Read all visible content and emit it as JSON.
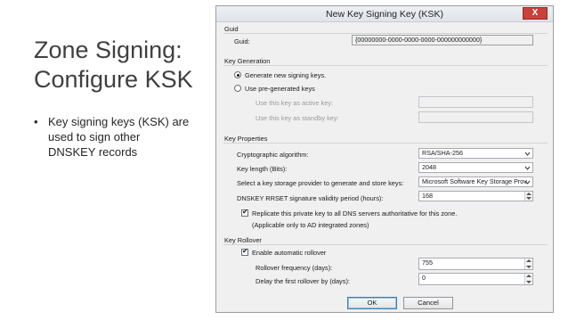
{
  "slide": {
    "title_line1": "Zone Signing:",
    "title_line2": "Configure KSK",
    "bullet_marker": "•",
    "bullet_line1": "Key signing keys (KSK) are",
    "bullet_line2": "used to sign other",
    "bullet_line3": "DNSKEY records"
  },
  "dialog": {
    "title": "New Key Signing Key (KSK)",
    "close_label": "X",
    "guid": {
      "group_label": "Guid",
      "field_label": "Guid:",
      "value": "{00000000-0000-0000-0000-000000000000}"
    },
    "key_generation": {
      "group_label": "Key Generation",
      "option_generate": "Generate new signing keys.",
      "option_pregenerated": "Use pre-generated keys",
      "active_key_label": "Use this key as active key:",
      "active_key_value": "",
      "standby_key_label": "Use this key as standby key:",
      "standby_key_value": "",
      "selected": "generate"
    },
    "key_properties": {
      "group_label": "Key Properties",
      "algorithm_label": "Cryptographic algorithm:",
      "algorithm_value": "RSA/SHA-256",
      "key_length_label": "Key length (Bits):",
      "key_length_value": "2048",
      "ksp_label": "Select a key storage provider to generate and store keys:",
      "ksp_value": "Microsoft Software Key Storage Prov",
      "rrset_label": "DNSKEY RRSET signature validity period (hours):",
      "rrset_value": "168",
      "replicate_label": "Replicate this private key to all DNS servers authoritative for this zone.",
      "replicate_note": "(Applicable only to AD integrated zones)",
      "replicate_checked": true
    },
    "key_rollover": {
      "group_label": "Key Rollover",
      "auto_rollover_label": "Enable automatic rollover",
      "auto_rollover_checked": true,
      "frequency_label": "Rollover frequency (days):",
      "frequency_value": "755",
      "delay_label": "Delay the first rollover by (days):",
      "delay_value": "0"
    },
    "buttons": {
      "ok": "OK",
      "cancel": "Cancel"
    },
    "check_glyph": "✔",
    "colors": {
      "close_button": "#c8413a",
      "default_button_border": "#3c7fb1"
    }
  }
}
